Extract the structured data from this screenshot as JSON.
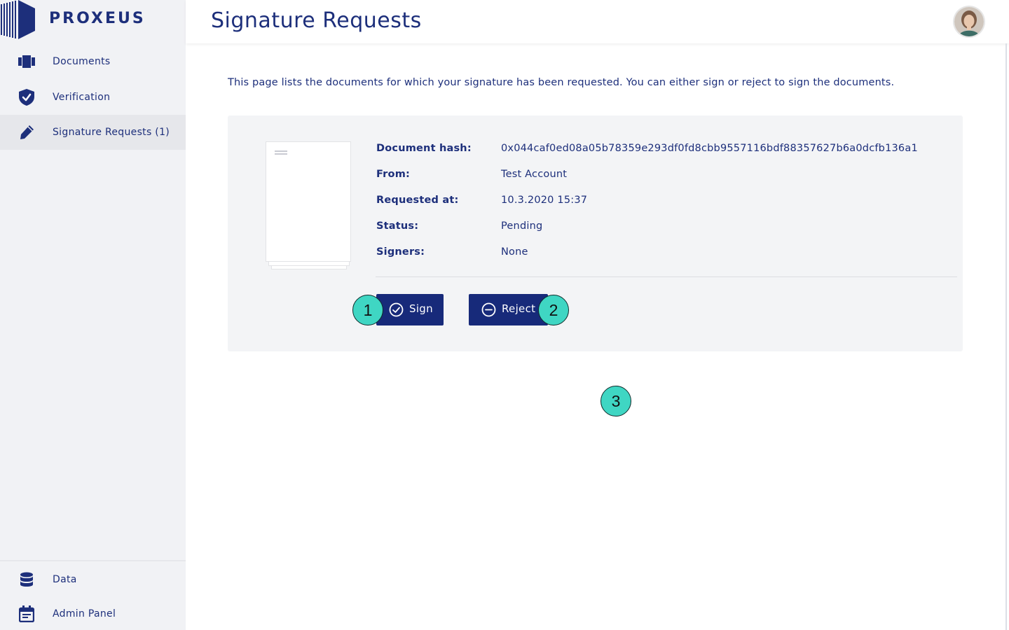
{
  "brand": {
    "name": "PROXEUS"
  },
  "sidebar": {
    "items": [
      {
        "label": "Documents",
        "icon": "documents-icon",
        "active": false
      },
      {
        "label": "Verification",
        "icon": "shield-check-icon",
        "active": false
      },
      {
        "label": "Signature Requests (1)",
        "icon": "pen-icon",
        "active": true
      }
    ],
    "bottom_items": [
      {
        "label": "Data",
        "icon": "database-icon"
      },
      {
        "label": "Admin Panel",
        "icon": "calendar-icon"
      }
    ]
  },
  "header": {
    "title": "Signature Requests"
  },
  "main": {
    "intro": "This page lists the documents for which your signature has been requested. You can either sign or reject to sign the documents.",
    "request": {
      "fields": [
        {
          "label": "Document hash:",
          "value": "0x044caf0ed08a05b78359e293df0fd8cbb9557116bdf88357627b6a0dcfb136a1"
        },
        {
          "label": "From:",
          "value": "Test Account"
        },
        {
          "label": "Requested at:",
          "value": "10.3.2020 15:37"
        },
        {
          "label": "Status:",
          "value": "Pending"
        },
        {
          "label": "Signers:",
          "value": "None"
        }
      ],
      "sign_label": "Sign",
      "reject_label": "Reject"
    }
  },
  "markers": [
    "1",
    "2",
    "3"
  ],
  "colors": {
    "brand_blue": "#172a7a",
    "text_blue": "#1d2f7b",
    "sidebar_bg": "#f1f2f5",
    "card_bg": "#f3f4f6",
    "marker_teal": "#3fd6c3"
  }
}
